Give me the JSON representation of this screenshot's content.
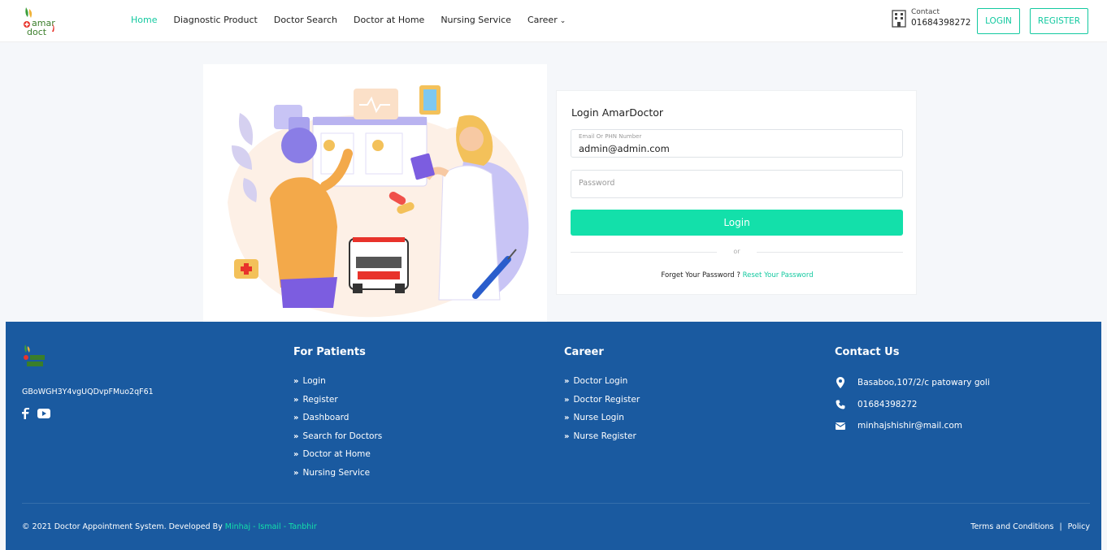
{
  "brand": {
    "logo_text_1": "amar",
    "logo_text_2": "doct"
  },
  "nav": {
    "items": [
      {
        "label": "Home",
        "active": true
      },
      {
        "label": "Diagnostic Product",
        "active": false
      },
      {
        "label": "Doctor Search",
        "active": false
      },
      {
        "label": "Doctor at Home",
        "active": false
      },
      {
        "label": "Nursing Service",
        "active": false
      },
      {
        "label": "Career",
        "active": false,
        "dropdown": true
      }
    ],
    "contact_label": "Contact",
    "contact_phone": "01684398272",
    "login_label": "LOGIN",
    "register_label": "REGISTER"
  },
  "login": {
    "title": "Login AmarDoctor",
    "email_label": "Email Or PHN Number",
    "email_value": "admin@admin.com",
    "password_placeholder": "Password",
    "submit_label": "Login",
    "or_text": "or",
    "forget_text": "Forget Your Password ? ",
    "reset_link": "Reset Your Password"
  },
  "footer": {
    "code": "GBoWGH3Y4vgUQDvpFMuo2qF61",
    "patients_title": "For Patients",
    "patients_links": [
      "Login",
      "Register",
      "Dashboard",
      "Search for Doctors",
      "Doctor at Home",
      "Nursing Service"
    ],
    "career_title": "Career",
    "career_links": [
      "Doctor Login",
      "Doctor Register",
      "Nurse Login",
      "Nurse Register"
    ],
    "contact_title": "Contact Us",
    "address": "Basaboo,107/2/c patowary goli",
    "phone": "01684398272",
    "email": "minhajshishir@mail.com",
    "copyright_prefix": "© 2021 Doctor Appointment System. Developed By ",
    "developers": "Minhaj - Ismail - Tanbhir",
    "terms": "Terms and Conditions",
    "separator": "|",
    "policy": "Policy"
  },
  "colors": {
    "accent": "#13c9a0",
    "button": "#13e0aa",
    "footer_bg": "#1a5aa0",
    "page_bg": "#f5f7fa"
  },
  "icons": [
    "building-icon",
    "facebook-icon",
    "youtube-icon",
    "location-pin-icon",
    "phone-icon",
    "mail-icon",
    "double-chevron-icon",
    "chevron-down-icon"
  ]
}
